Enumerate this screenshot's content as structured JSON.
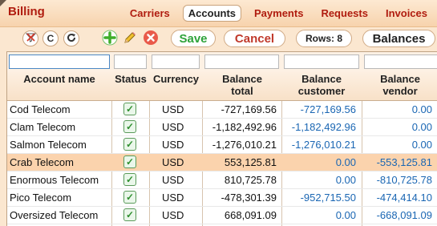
{
  "app": {
    "title": "Billing"
  },
  "nav": [
    {
      "label": "Carriers",
      "active": false
    },
    {
      "label": "Accounts",
      "active": true
    },
    {
      "label": "Payments",
      "active": false
    },
    {
      "label": "Requests",
      "active": false
    },
    {
      "label": "Invoices",
      "active": false
    }
  ],
  "toolbar": {
    "refresh_label": "C",
    "save_label": "Save",
    "cancel_label": "Cancel",
    "rows_label": "Rows: 8",
    "balances_label": "Balances"
  },
  "table": {
    "columns": [
      "Account name",
      "Status",
      "Currency",
      "Balance total",
      "Balance customer",
      "Balance vendor"
    ],
    "rows": [
      {
        "name": "Cod Telecom",
        "status": true,
        "currency": "USD",
        "total": "-727,169.56",
        "customer": "-727,169.56",
        "vendor": "0.00",
        "highlight": false
      },
      {
        "name": "Clam Telecom",
        "status": true,
        "currency": "USD",
        "total": "-1,182,492.96",
        "customer": "-1,182,492.96",
        "vendor": "0.00",
        "highlight": false
      },
      {
        "name": "Salmon Telecom",
        "status": true,
        "currency": "USD",
        "total": "-1,276,010.21",
        "customer": "-1,276,010.21",
        "vendor": "0.00",
        "highlight": false
      },
      {
        "name": "Crab Telecom",
        "status": true,
        "currency": "USD",
        "total": "553,125.81",
        "customer": "0.00",
        "vendor": "-553,125.81",
        "highlight": true
      },
      {
        "name": "Enormous Telecom",
        "status": true,
        "currency": "USD",
        "total": "810,725.78",
        "customer": "0.00",
        "vendor": "-810,725.78",
        "highlight": false
      },
      {
        "name": "Pico Telecom",
        "status": true,
        "currency": "USD",
        "total": "-478,301.39",
        "customer": "-952,715.50",
        "vendor": "-474,414.10",
        "highlight": false
      },
      {
        "name": "Oversized Telecom",
        "status": true,
        "currency": "USD",
        "total": "668,091.09",
        "customer": "0.00",
        "vendor": "-668,091.09",
        "highlight": false
      }
    ]
  },
  "colors": {
    "accent": "#b01c0f",
    "save": "#2ea33a",
    "cancel": "#c0392b",
    "highlight_row": "#fbd3ad",
    "link_blue": "#1a66b3"
  }
}
